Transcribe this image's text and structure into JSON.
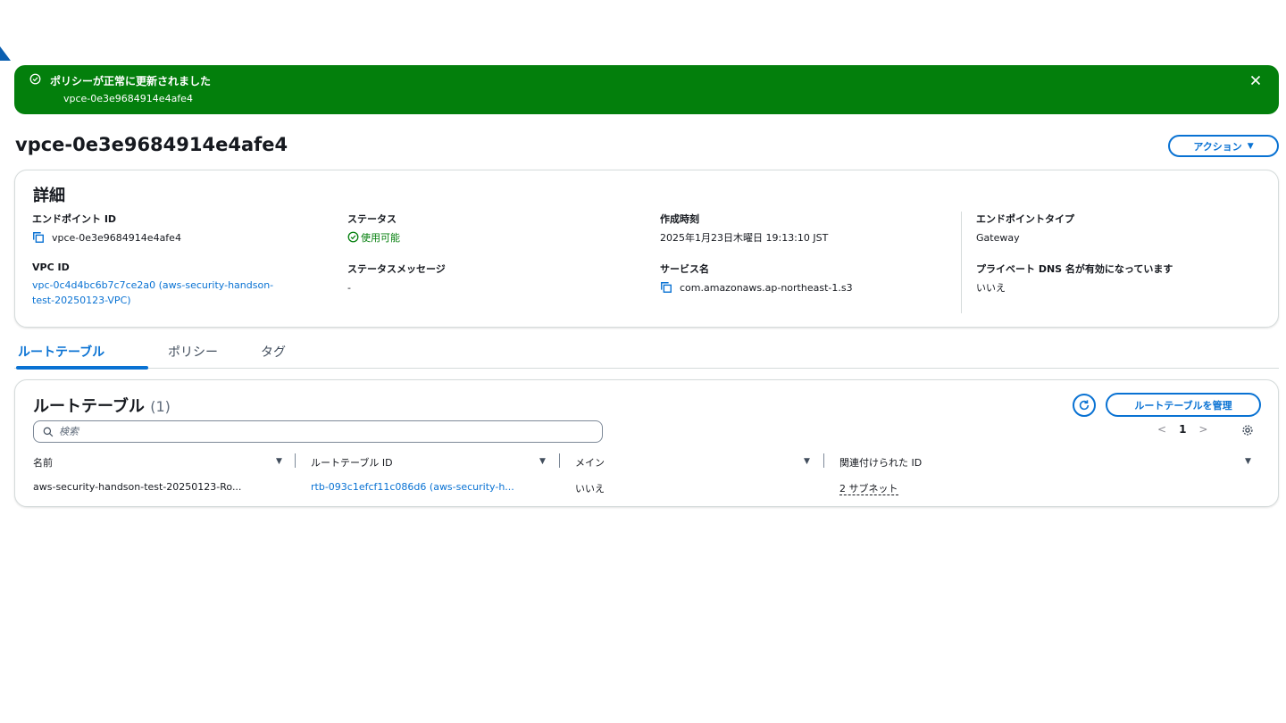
{
  "flash": {
    "title": "ポリシーが正常に更新されました",
    "subtitle": "vpce-0e3e9684914e4afe4",
    "status_color": "#037f0c"
  },
  "header": {
    "title": "vpce-0e3e9684914e4afe4",
    "actions_label": "アクション"
  },
  "details": {
    "section_title": "詳細",
    "endpoint_id": {
      "label": "エンドポイント ID",
      "value": "vpce-0e3e9684914e4afe4"
    },
    "status": {
      "label": "ステータス",
      "value": "使用可能"
    },
    "created": {
      "label": "作成時刻",
      "value": "2025年1月23日木曜日 19:13:10 JST"
    },
    "endpoint_type": {
      "label": "エンドポイントタイプ",
      "value": "Gateway"
    },
    "vpc_id": {
      "label": "VPC ID",
      "value_line1": "vpc-0c4d4bc6b7c7ce2a0 (aws-security-handson-",
      "value_line2": "test-20250123-VPC)"
    },
    "status_message": {
      "label": "ステータスメッセージ",
      "value": "-"
    },
    "service_name": {
      "label": "サービス名",
      "value": "com.amazonaws.ap-northeast-1.s3"
    },
    "private_dns": {
      "label": "プライベート DNS 名が有効になっています",
      "value": "いいえ"
    }
  },
  "tabs": [
    {
      "label": "ルートテーブル",
      "active": true
    },
    {
      "label": "ポリシー",
      "active": false
    },
    {
      "label": "タグ",
      "active": false
    }
  ],
  "route_tables": {
    "title": "ルートテーブル",
    "count": "(1)",
    "manage_label": "ルートテーブルを管理",
    "search_placeholder": "検索",
    "page": "1",
    "columns": [
      "名前",
      "ルートテーブル ID",
      "メイン",
      "関連付けられた ID"
    ],
    "rows": [
      {
        "name": "aws-security-handson-test-20250123-Ro...",
        "route_table_id": "rtb-093c1efcf11c086d6 (aws-security-h...",
        "main": "いいえ",
        "associated": "2 サブネット"
      }
    ]
  },
  "colors": {
    "accent": "#0972d3",
    "success": "#037f0c",
    "border": "#d5dbdb"
  }
}
